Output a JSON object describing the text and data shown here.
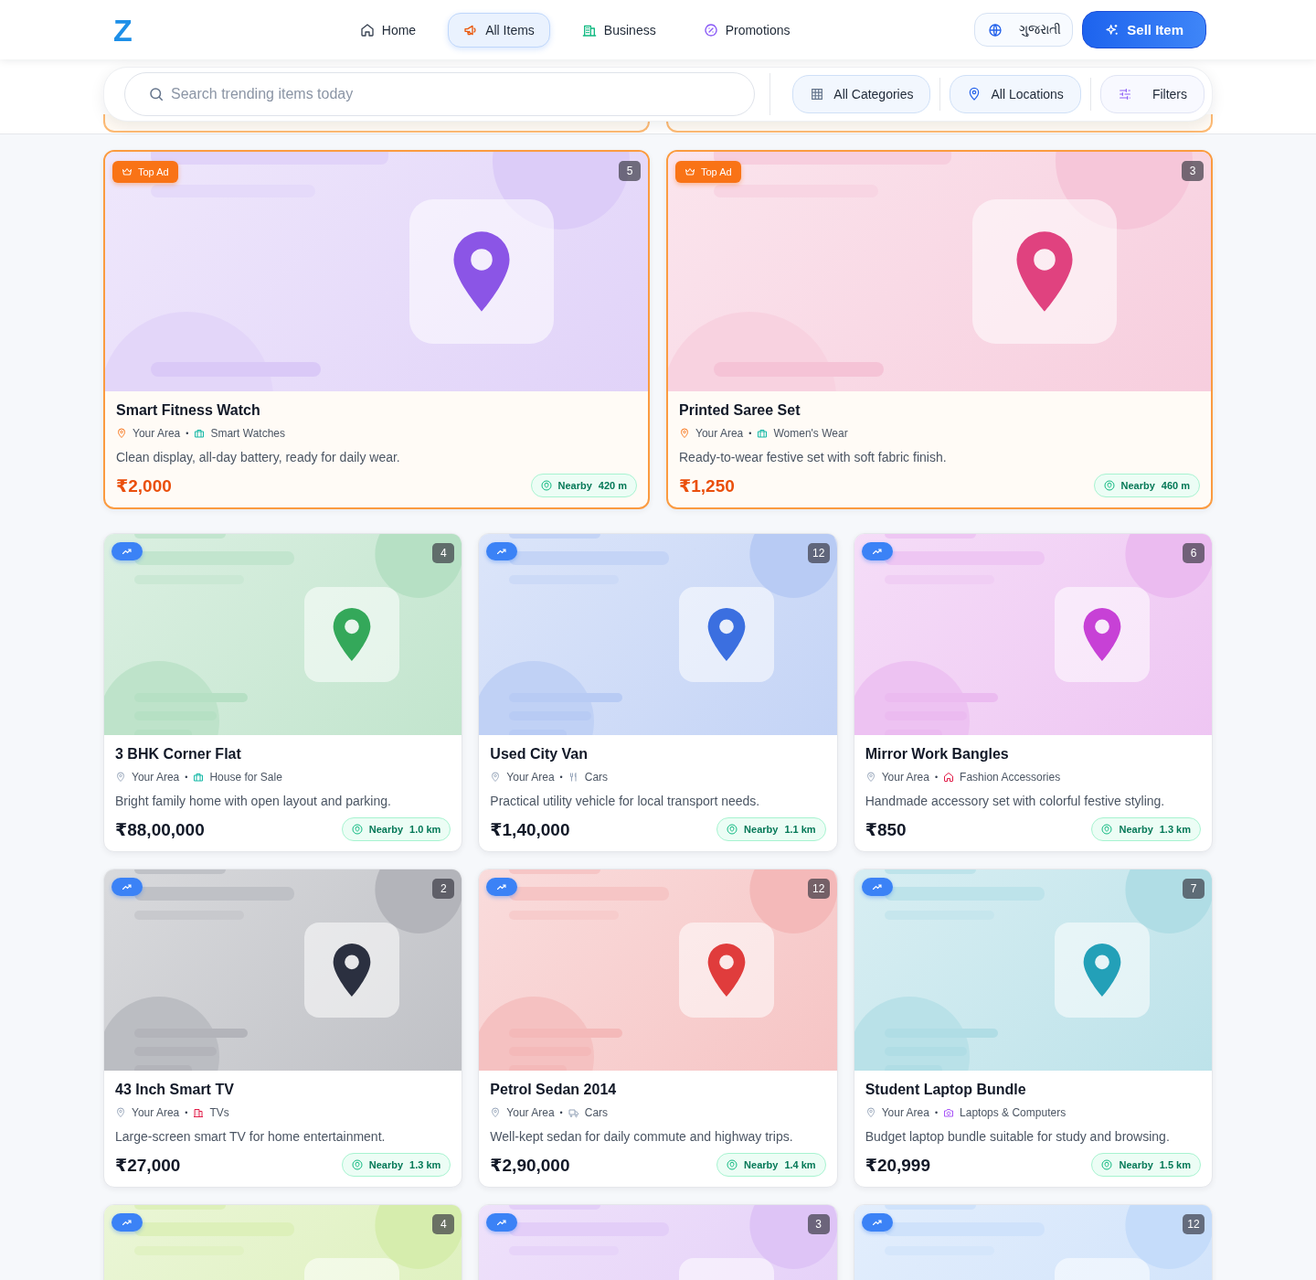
{
  "header": {
    "logo": "Z",
    "nav": [
      {
        "label": "Home",
        "selected": false
      },
      {
        "label": "All Items",
        "selected": true
      },
      {
        "label": "Business",
        "selected": false
      },
      {
        "label": "Promotions",
        "selected": false
      }
    ],
    "language": "ગુજરાતી",
    "sell_button": "Sell Item"
  },
  "search": {
    "placeholder": "Search trending items today",
    "filters": [
      {
        "label": "All Categories"
      },
      {
        "label": "All Locations"
      },
      {
        "label": "Filters"
      }
    ]
  },
  "featured_listings": [
    {
      "badge": "Top Ad",
      "count": "5",
      "color": "#8b55e6",
      "title": "Smart Fitness Watch",
      "location": "Your Area",
      "separator": "•",
      "category": "Smart Watches",
      "description": "Clean display, all-day battery, ready for daily wear.",
      "price": "₹2,000",
      "nearby": "Nearby",
      "distance": "420 m"
    },
    {
      "badge": "Top Ad",
      "count": "3",
      "color": "#e0427f",
      "title": "Printed Saree Set",
      "location": "Your Area",
      "separator": "•",
      "category": "Women's Wear",
      "description": "Ready-to-wear festive set with soft fabric finish.",
      "price": "₹1,250",
      "nearby": "Nearby",
      "distance": "460 m"
    }
  ],
  "listings": [
    {
      "count": "4",
      "color": "#34a85a",
      "title": "3 BHK Corner Flat",
      "location": "Your Area",
      "separator": "•",
      "category": "House for Sale",
      "description": "Bright family home with open layout and parking.",
      "price": "₹88,00,000",
      "nearby": "Nearby",
      "distance": "1.0 km"
    },
    {
      "count": "12",
      "color": "#3b6fe0",
      "title": "Used City Van",
      "location": "Your Area",
      "separator": "•",
      "category": "Cars",
      "description": "Practical utility vehicle for local transport needs.",
      "price": "₹1,40,000",
      "nearby": "Nearby",
      "distance": "1.1 km"
    },
    {
      "count": "6",
      "color": "#c741d6",
      "title": "Mirror Work Bangles",
      "location": "Your Area",
      "separator": "•",
      "category": "Fashion Accessories",
      "description": "Handmade accessory set with colorful festive styling.",
      "price": "₹850",
      "nearby": "Nearby",
      "distance": "1.3 km"
    },
    {
      "count": "2",
      "color": "#2b3040",
      "title": "43 Inch Smart TV",
      "location": "Your Area",
      "separator": "•",
      "category": "TVs",
      "description": "Large-screen smart TV for home entertainment.",
      "price": "₹27,000",
      "nearby": "Nearby",
      "distance": "1.3 km"
    },
    {
      "count": "12",
      "color": "#e03c3c",
      "title": "Petrol Sedan 2014",
      "location": "Your Area",
      "separator": "•",
      "category": "Cars",
      "description": "Well-kept sedan for daily commute and highway trips.",
      "price": "₹2,90,000",
      "nearby": "Nearby",
      "distance": "1.4 km"
    },
    {
      "count": "7",
      "color": "#23a0b8",
      "title": "Student Laptop Bundle",
      "location": "Your Area",
      "separator": "•",
      "category": "Laptops & Computers",
      "description": "Budget laptop bundle suitable for study and browsing.",
      "price": "₹20,999",
      "nearby": "Nearby",
      "distance": "1.5 km"
    },
    {
      "count": "4"
    },
    {
      "count": "3"
    },
    {
      "count": "12"
    }
  ]
}
